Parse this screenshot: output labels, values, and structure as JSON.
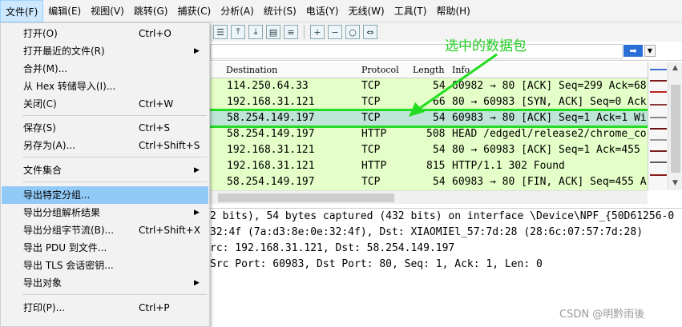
{
  "menubar": {
    "items": [
      "文件(F)",
      "编辑(E)",
      "视图(V)",
      "跳转(G)",
      "捕获(C)",
      "分析(A)",
      "统计(S)",
      "电话(Y)",
      "无线(W)",
      "工具(T)",
      "帮助(H)"
    ]
  },
  "file_menu": {
    "items": [
      {
        "label": "打开(O)",
        "shortcut": "Ctrl+O",
        "submenu": false
      },
      {
        "label": "打开最近的文件(R)",
        "shortcut": "",
        "submenu": true
      },
      {
        "label": "合并(M)...",
        "shortcut": "",
        "submenu": false
      },
      {
        "label": "从 Hex 转储导入(I)...",
        "shortcut": "",
        "submenu": false
      },
      {
        "label": "关闭(C)",
        "shortcut": "Ctrl+W",
        "submenu": false
      },
      {
        "label": "保存(S)",
        "shortcut": "Ctrl+S",
        "submenu": false
      },
      {
        "label": "另存为(A)...",
        "shortcut": "Ctrl+Shift+S",
        "submenu": false
      },
      {
        "label": "文件集合",
        "shortcut": "",
        "submenu": true
      },
      {
        "label": "导出特定分组...",
        "shortcut": "",
        "submenu": false,
        "highlighted": true
      },
      {
        "label": "导出分组解析结果",
        "shortcut": "",
        "submenu": true
      },
      {
        "label": "导出分组字节流(B)...",
        "shortcut": "Ctrl+Shift+X",
        "submenu": false
      },
      {
        "label": "导出 PDU 到文件...",
        "shortcut": "",
        "submenu": false
      },
      {
        "label": "导出 TLS 会话密钥...",
        "shortcut": "",
        "submenu": false
      },
      {
        "label": "导出对象",
        "shortcut": "",
        "submenu": true
      },
      {
        "label": "打印(P)...",
        "shortcut": "Ctrl+P",
        "submenu": false
      }
    ]
  },
  "packet_list": {
    "columns": [
      "Destination",
      "Protocol",
      "Length",
      "Info"
    ],
    "rows": [
      {
        "dst": "114.250.64.33",
        "proto": "TCP",
        "len": "54",
        "info": "60982 → 80 [ACK] Seq=299 Ack=68"
      },
      {
        "dst": "192.168.31.121",
        "proto": "TCP",
        "len": "66",
        "info": "80 → 60983 [SYN, ACK] Seq=0 Ack"
      },
      {
        "dst": "58.254.149.197",
        "proto": "TCP",
        "len": "54",
        "info": "60983 → 80 [ACK] Seq=1 Ack=1 Wi",
        "selected": true
      },
      {
        "dst": "58.254.149.197",
        "proto": "HTTP",
        "len": "508",
        "info": "HEAD /edgedl/release2/chrome_co"
      },
      {
        "dst": "192.168.31.121",
        "proto": "TCP",
        "len": "54",
        "info": "80 → 60983 [ACK] Seq=1 Ack=455"
      },
      {
        "dst": "192.168.31.121",
        "proto": "HTTP",
        "len": "815",
        "info": "HTTP/1.1 302 Found"
      },
      {
        "dst": "58.254.149.197",
        "proto": "TCP",
        "len": "54",
        "info": "60983 → 80 [FIN, ACK] Seq=455 A"
      }
    ]
  },
  "detail": {
    "lines": [
      "2 bits), 54 bytes captured (432 bits) on interface \\Device\\NPF_{50D61256-0",
      "32:4f (7a:d3:8e:0e:32:4f), Dst: XIAOMIEl_57:7d:28 (28:6c:07:57:7d:28)",
      "rc: 192.168.31.121, Dst: 58.254.149.197",
      "Src Port: 60983, Dst Port: 80, Seq: 1, Ack: 1, Len: 0"
    ]
  },
  "annotation": {
    "text": "选中的数据包",
    "color": "#22cc22"
  },
  "watermark": "CSDN @明黔雨後",
  "colors": {
    "tcp_row": "#e4ffc7",
    "selected_row": "#bfe5d8",
    "menu_highlight": "#91c9f7"
  }
}
